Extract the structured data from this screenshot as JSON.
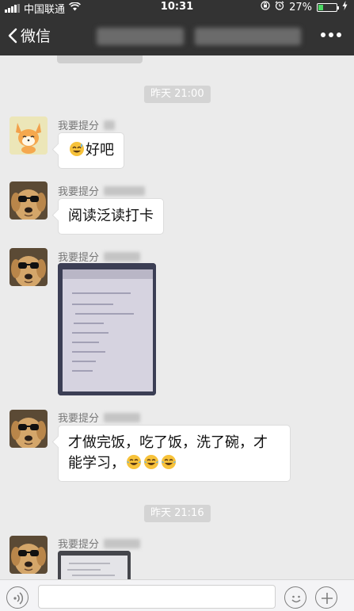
{
  "status_bar": {
    "carrier": "中国联通",
    "time": "10:31",
    "battery": "27%",
    "battery_level": 0.27
  },
  "nav": {
    "back_label": "微信"
  },
  "timestamps": [
    "昨天 21:00",
    "昨天 21:16"
  ],
  "messages": [
    {
      "sender": "我要提分",
      "text": "好吧",
      "emoji_before": "sweat-smile-emoji"
    },
    {
      "sender": "我要提分",
      "text": "阅读泛读打卡"
    },
    {
      "sender": "我要提分",
      "image": "homework-photo"
    },
    {
      "sender": "我要提分",
      "line1": "才做完饭，吃了饭，洗了碗，才",
      "line2": "能学习，",
      "emojis": [
        "tears-of-joy-emoji",
        "tears-of-joy-emoji",
        "tears-of-joy-emoji"
      ]
    },
    {
      "sender": "我要提分",
      "image": "screenshot-photo"
    }
  ],
  "colors": {
    "header_bg": "#333333",
    "chat_bg": "#ebebeb",
    "bubble_bg": "#ffffff"
  }
}
